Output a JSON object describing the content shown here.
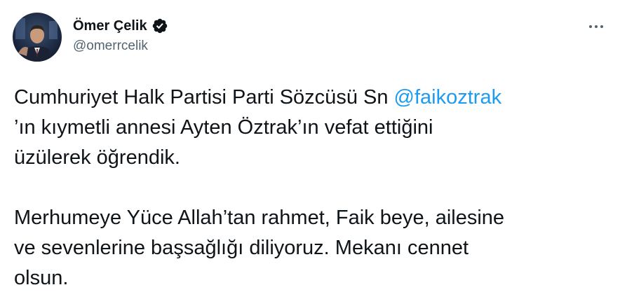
{
  "tweet": {
    "author": {
      "display_name": "Ömer Çelik",
      "handle": "@omerrcelik",
      "verified": true,
      "avatar_icon": "profile-photo"
    },
    "more_icon": "ellipsis-icon",
    "text": {
      "line1_prefix": "Cumhuriyet Halk Partisi Parti Sözcüsü Sn ",
      "mention": "@faikoztrak",
      "line2": "’ın kıymetli annesi Ayten Öztrak’ın vefat ettiğini",
      "line3": "üzülerek öğrendik.",
      "para2_line1": "Merhumeye Yüce Allah’tan rahmet, Faik beye, ailesine",
      "para2_line2": "ve sevenlerine başsağlığı diliyoruz. Mekanı cennet",
      "para2_line3": "olsun."
    },
    "colors": {
      "mention": "#1d9bf0",
      "text": "#0f1419",
      "secondary": "#536471",
      "background": "#ffffff"
    }
  }
}
